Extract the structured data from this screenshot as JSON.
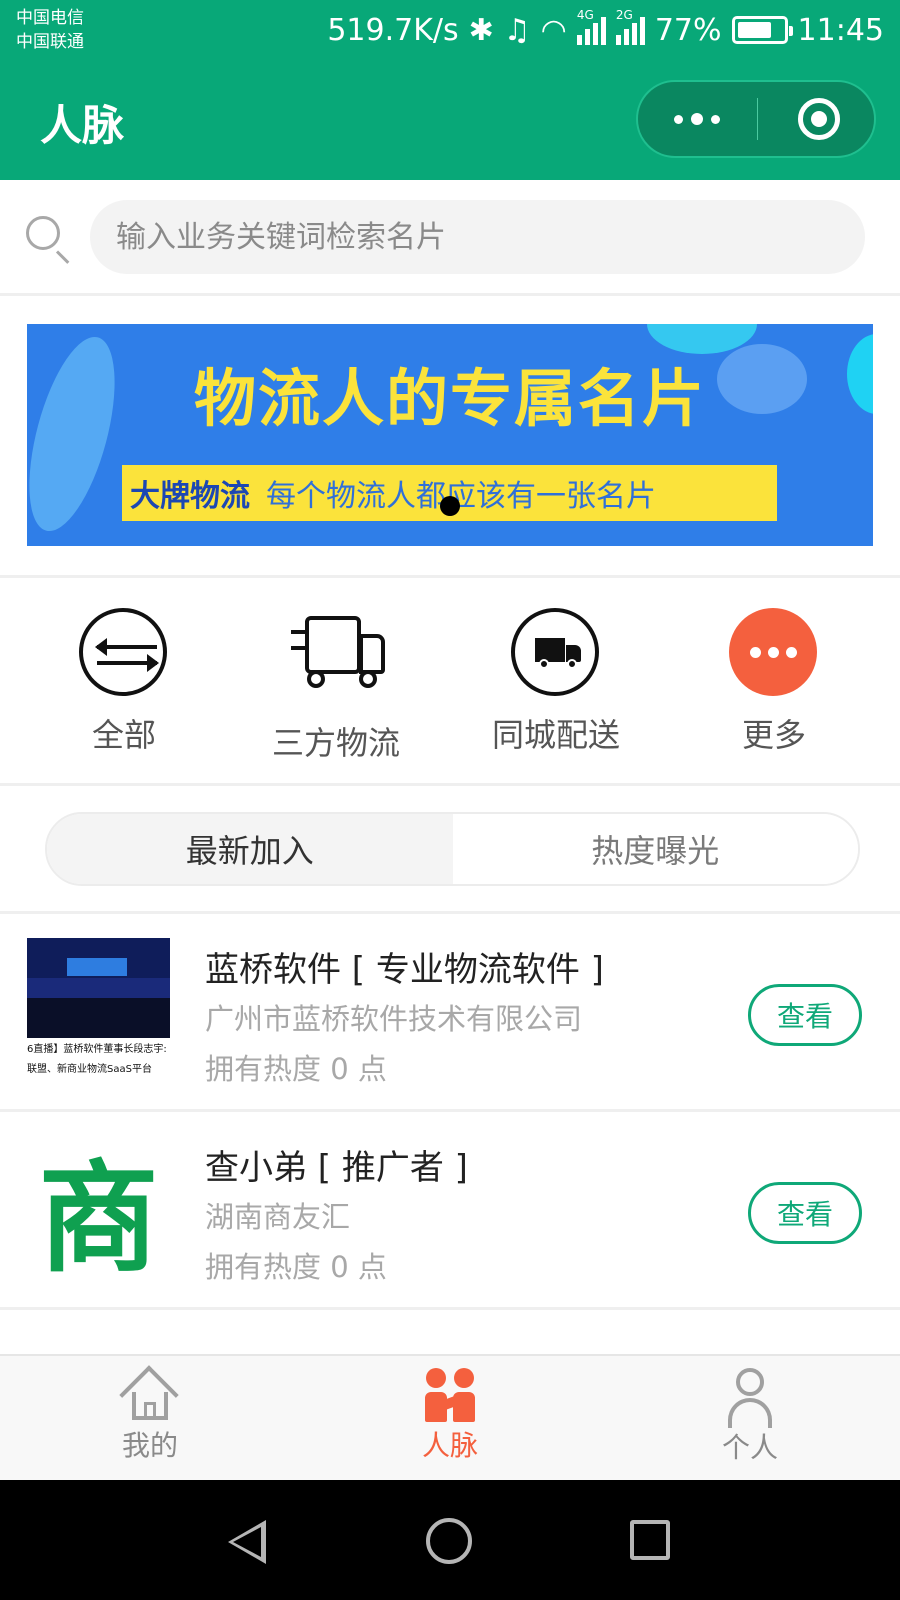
{
  "status_bar": {
    "carrier1": "中国电信",
    "carrier2": "中国联通",
    "speed": "519.7K/s",
    "net1": "4G",
    "net1b": "2G",
    "net2": "2G",
    "battery": "77%",
    "battery_level": 0.77,
    "time": "11:45"
  },
  "nav": {
    "title": "人脉"
  },
  "search": {
    "placeholder": "输入业务关键词检索名片"
  },
  "banner": {
    "title": "物流人的专属名片",
    "brand": "大牌物流",
    "slogan": "每个物流人都应该有一张名片"
  },
  "categories": [
    {
      "label": "全部",
      "icon": "swap-arrows-icon"
    },
    {
      "label": "三方物流",
      "icon": "truck-outline-icon"
    },
    {
      "label": "同城配送",
      "icon": "truck-circle-icon"
    },
    {
      "label": "更多",
      "icon": "more-dots-icon"
    }
  ],
  "tabs": [
    {
      "label": "最新加入",
      "active": true
    },
    {
      "label": "热度曝光",
      "active": false
    }
  ],
  "cards": [
    {
      "name": "蓝桥软件 [ 专业物流软件 ]",
      "company": "广州市蓝桥软件技术有限公司",
      "heat": "拥有热度 0 点",
      "thumb_caption1": "6直播】蓝桥软件董事长段志宇:",
      "thumb_caption2": "联盟、新商业物流SaaS平台",
      "action": "查看"
    },
    {
      "name": "查小弟 [ 推广者 ]",
      "company": "湖南商友汇",
      "heat": "拥有热度 0 点",
      "thumb_char": "商",
      "action": "查看"
    }
  ],
  "tabbar": [
    {
      "label": "我的",
      "icon": "home-icon"
    },
    {
      "label": "人脉",
      "icon": "people-icon"
    },
    {
      "label": "个人",
      "icon": "user-icon"
    }
  ],
  "colors": {
    "primary": "#08a878",
    "accent": "#f4603e",
    "banner_blue": "#2f7ee8",
    "banner_yellow": "#fbe33b"
  }
}
